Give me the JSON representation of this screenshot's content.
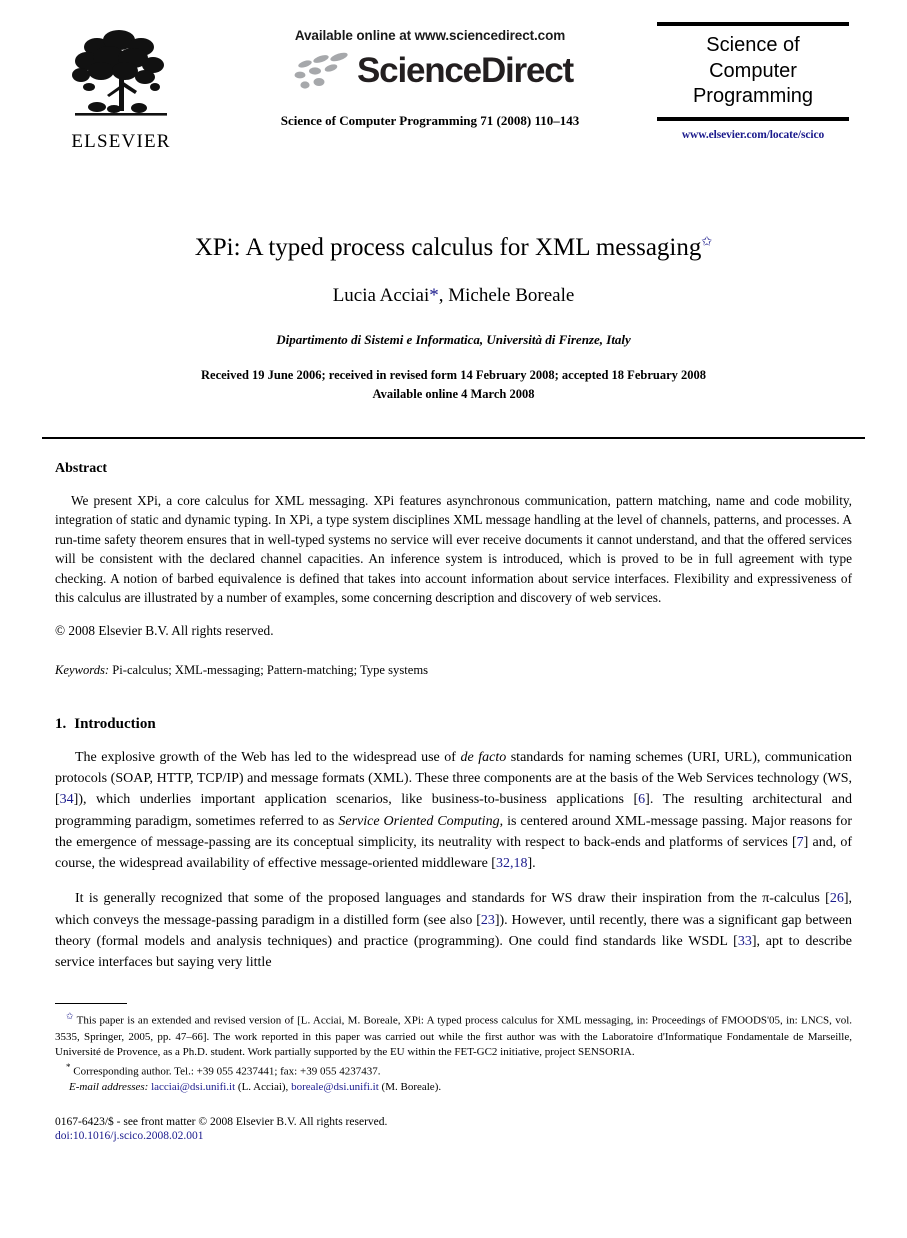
{
  "masthead": {
    "publisher_logo_text": "ELSEVIER",
    "publisher_logo_icon": "elsevier-tree-icon",
    "sciencedirect": {
      "available_line": "Available online at www.sciencedirect.com",
      "wordmark": "ScienceDirect",
      "logo_icon": "sciencedirect-dots-icon"
    },
    "journal_citation": "Science of Computer Programming 71 (2008) 110–143",
    "journal_box": {
      "title_line1": "Science of",
      "title_line2": "Computer",
      "title_line3": "Programming",
      "url": "www.elsevier.com/locate/scico",
      "url_color": "#1a1a8c"
    }
  },
  "article": {
    "title": "XPi: A typed process calculus for XML messaging",
    "title_footnote_mark": "✩",
    "authors": "Lucia Acciai",
    "author_star": "*",
    "authors_rest": ", Michele Boreale",
    "affiliation": "Dipartimento di Sistemi e Informatica, Università di Firenze, Italy",
    "received_line": "Received 19 June 2006; received in revised form 14 February 2008; accepted 18 February 2008",
    "available_line": "Available online 4 March 2008"
  },
  "abstract": {
    "heading": "Abstract",
    "body": "We present XPi, a core calculus for XML messaging. XPi features asynchronous communication, pattern matching, name and code mobility, integration of static and dynamic typing. In XPi, a type system disciplines XML message handling at the level of channels, patterns, and processes. A run-time safety theorem ensures that in well-typed systems no service will ever receive documents it cannot understand, and that the offered services will be consistent with the declared channel capacities. An inference system is introduced, which is proved to be in full agreement with type checking. A notion of barbed equivalence is defined that takes into account information about service interfaces. Flexibility and expressiveness of this calculus are illustrated by a number of examples, some concerning description and discovery of web services.",
    "copyright": "© 2008 Elsevier B.V. All rights reserved.",
    "keywords_label": "Keywords:",
    "keywords_value": "Pi-calculus; XML-messaging; Pattern-matching; Type systems"
  },
  "introduction": {
    "number": "1.",
    "heading": "Introduction",
    "paragraph1": {
      "part1": "The explosive growth of the Web has led to the widespread use of ",
      "italic1": "de facto",
      "part2": " standards for naming schemes (URI, URL), communication protocols (SOAP, HTTP, TCP/IP) and message formats (XML). These three components are at the basis of the Web Services technology (WS, [",
      "ref1": "34",
      "part3": "]), which underlies important application scenarios, like business-to-business applications [",
      "ref2": "6",
      "part4": "]. The resulting architectural and programming paradigm, sometimes referred to as ",
      "italic2": "Service Oriented Computing",
      "part5": ", is centered around XML-message passing. Major reasons for the emergence of message-passing are its conceptual simplicity, its neutrality with respect to back-ends and platforms of services [",
      "ref3": "7",
      "part6": "] and, of course, the widespread availability of effective message-oriented middleware [",
      "ref4": "32,18",
      "part7": "]."
    },
    "paragraph2": {
      "part1": "It is generally recognized that some of the proposed languages and standards for WS draw their inspiration from the π-calculus [",
      "ref1": "26",
      "part2": "], which conveys the message-passing paradigm in a distilled form (see also [",
      "ref2": "23",
      "part3": "]). However, until recently, there was a significant gap between theory (formal models and analysis techniques) and practice (programming). One could find standards like WSDL [",
      "ref3": "33",
      "part4": "], apt to describe service interfaces but saying very little"
    }
  },
  "footnotes": {
    "star_note_mark": "✩",
    "star_note": "This paper is an extended and revised version of [L. Acciai, M. Boreale, XPi: A typed process calculus for XML messaging, in: Proceedings of FMOODS'05, in: LNCS, vol. 3535, Springer, 2005, pp. 47–66]. The work reported in this paper was carried out while the first author was with the Laboratoire d'Informatique Fondamentale de Marseille, Université de Provence, as a Ph.D. student. Work partially supported by the EU within the FET-GC2 initiative, project SENSORIA.",
    "corresponding_mark": "*",
    "corresponding": "Corresponding author. Tel.: +39 055 4237441; fax: +39 055 4237437.",
    "email_label": "E-mail addresses:",
    "email1": "lacciai@dsi.unifi.it",
    "email1_name": " (L. Acciai), ",
    "email2": "boreale@dsi.unifi.it",
    "email2_name": " (M. Boreale)."
  },
  "colophon": {
    "issn_line": "0167-6423/$ - see front matter © 2008 Elsevier B.V. All rights reserved.",
    "doi": "doi:10.1016/j.scico.2008.02.001"
  }
}
